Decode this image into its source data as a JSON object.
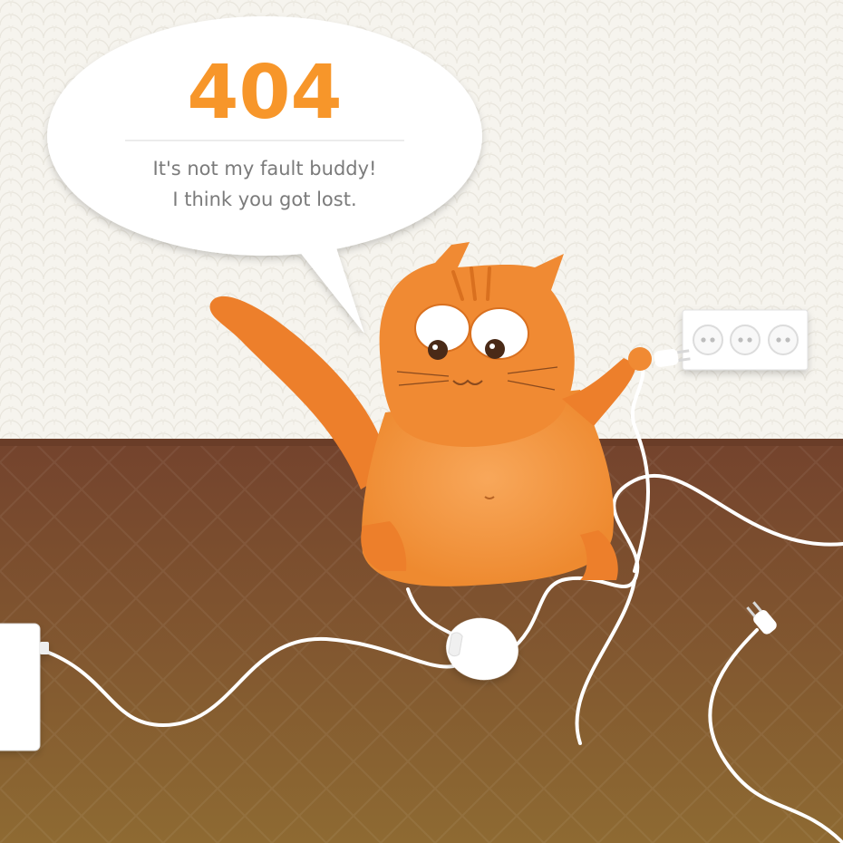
{
  "error_page": {
    "code": "404",
    "message_line1": "It's not my fault buddy!",
    "message_line2": "I think you got lost."
  },
  "colors": {
    "accent": "#f7962a",
    "message": "#7b7b7b",
    "wall": "#f6f4ee",
    "floor_top": "#7a4a30",
    "floor_bottom": "#8e6a32",
    "cat": "#f28c35"
  },
  "icons": [
    "speech-bubble",
    "cat-illustration",
    "wall-socket",
    "mouse",
    "plug",
    "power-adapter",
    "cable"
  ]
}
